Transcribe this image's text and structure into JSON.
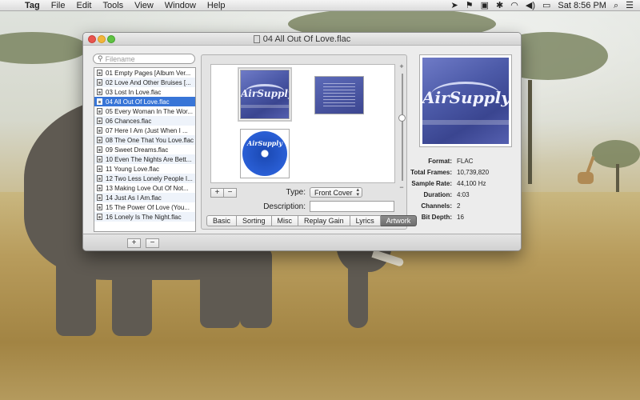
{
  "menubar": {
    "app_name": "Tag",
    "items": [
      "File",
      "Edit",
      "Tools",
      "View",
      "Window",
      "Help"
    ],
    "clock": "Sat 8:56 PM"
  },
  "window": {
    "title": "04 All Out Of Love.flac"
  },
  "search": {
    "placeholder": "Filename"
  },
  "files": [
    "01 Empty Pages [Album Ver...",
    "02 Love And Other Bruises [...",
    "03 Lost In Love.flac",
    "04 All Out Of Love.flac",
    "05 Every Woman In The Wor...",
    "06 Chances.flac",
    "07 Here I Am (Just When I ...",
    "08 The One That You Love.flac",
    "09 Sweet Dreams.flac",
    "10 Even The Nights Are Bett...",
    "11 Young Love.flac",
    "12 Two Less Lonely People I...",
    "13 Making Love Out Of Not...",
    "14 Just As I Am.flac",
    "15 The Power Of Love (You...",
    "16 Lonely Is The Night.flac"
  ],
  "selected_file_index": 3,
  "artwork": {
    "add_label": "+",
    "remove_label": "−",
    "type_label": "Type:",
    "type_value": "Front Cover",
    "description_label": "Description:",
    "description_value": "",
    "zoom_plus": "+",
    "zoom_minus": "−",
    "cover_logo": "AirSupply",
    "disc_logo": "AirSupply"
  },
  "tabs": [
    "Basic",
    "Sorting",
    "Misc",
    "Replay Gain",
    "Lyrics",
    "Artwork"
  ],
  "active_tab": "Artwork",
  "info": {
    "format_label": "Format:",
    "format": "FLAC",
    "frames_label": "Total Frames:",
    "frames": "10,739,820",
    "rate_label": "Sample Rate:",
    "rate": "44,100 Hz",
    "duration_label": "Duration:",
    "duration": "4:03",
    "channels_label": "Channels:",
    "channels": "2",
    "depth_label": "Bit Depth:",
    "depth": "16"
  },
  "bottombar": {
    "add_label": "+",
    "remove_label": "−"
  },
  "colors": {
    "selection": "#3875d7",
    "cover_blue": "#4c5aa8",
    "disc_blue": "#2457c6"
  }
}
